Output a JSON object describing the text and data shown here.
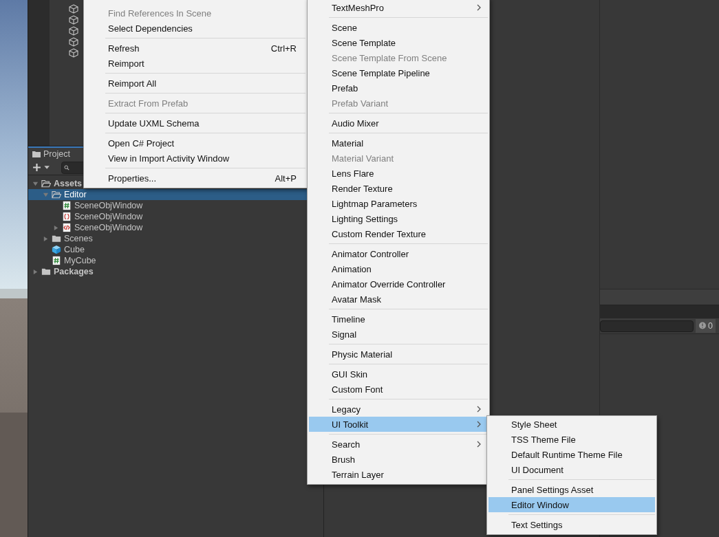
{
  "project": {
    "tab": "Project",
    "tree": [
      {
        "label": "Assets",
        "kind": "folder",
        "expanded": true,
        "selected": false,
        "children": [
          {
            "label": "Editor",
            "kind": "folder",
            "expanded": true,
            "selected": true,
            "children": [
              {
                "label": "SceneObjWindow",
                "kind": "script",
                "selected": false
              },
              {
                "label": "SceneObjWindow",
                "kind": "stylesheet",
                "selected": false
              },
              {
                "label": "SceneObjWindow",
                "kind": "uxml",
                "expanded": false,
                "selected": false
              }
            ]
          },
          {
            "label": "Scenes",
            "kind": "folder",
            "expanded": false,
            "selected": false
          },
          {
            "label": "Cube",
            "kind": "prefab",
            "selected": false
          },
          {
            "label": "MyCube",
            "kind": "script",
            "selected": false
          }
        ]
      },
      {
        "label": "Packages",
        "kind": "folder",
        "expanded": false,
        "selected": false
      }
    ]
  },
  "console": {
    "warning_count": "0"
  },
  "menus": [
    {
      "items": [
        {
          "kind": "item",
          "label": "Find References In Scene",
          "disabled": true,
          "selected": false,
          "submenu": false
        },
        {
          "kind": "item",
          "label": "Select Dependencies",
          "disabled": false,
          "selected": false,
          "submenu": false
        },
        {
          "kind": "separator"
        },
        {
          "kind": "item",
          "label": "Refresh",
          "shortcut": "Ctrl+R",
          "disabled": false,
          "selected": false,
          "submenu": false
        },
        {
          "kind": "item",
          "label": "Reimport",
          "disabled": false,
          "selected": false,
          "submenu": false
        },
        {
          "kind": "separator"
        },
        {
          "kind": "item",
          "label": "Reimport All",
          "disabled": false,
          "selected": false,
          "submenu": false
        },
        {
          "kind": "separator"
        },
        {
          "kind": "item",
          "label": "Extract From Prefab",
          "disabled": true,
          "selected": false,
          "submenu": false
        },
        {
          "kind": "separator"
        },
        {
          "kind": "item",
          "label": "Update UXML Schema",
          "disabled": false,
          "selected": false,
          "submenu": false
        },
        {
          "kind": "separator"
        },
        {
          "kind": "item",
          "label": "Open C# Project",
          "disabled": false,
          "selected": false,
          "submenu": false
        },
        {
          "kind": "item",
          "label": "View in Import Activity Window",
          "disabled": false,
          "selected": false,
          "submenu": false
        },
        {
          "kind": "separator"
        },
        {
          "kind": "item",
          "label": "Properties...",
          "shortcut": "Alt+P",
          "disabled": false,
          "selected": false,
          "submenu": false
        }
      ]
    },
    {
      "items": [
        {
          "kind": "item",
          "label": "TextMeshPro",
          "disabled": false,
          "selected": false,
          "submenu": true
        },
        {
          "kind": "separator"
        },
        {
          "kind": "item",
          "label": "Scene",
          "disabled": false,
          "selected": false,
          "submenu": false
        },
        {
          "kind": "item",
          "label": "Scene Template",
          "disabled": false,
          "selected": false,
          "submenu": false
        },
        {
          "kind": "item",
          "label": "Scene Template From Scene",
          "disabled": true,
          "selected": false,
          "submenu": false
        },
        {
          "kind": "item",
          "label": "Scene Template Pipeline",
          "disabled": false,
          "selected": false,
          "submenu": false
        },
        {
          "kind": "item",
          "label": "Prefab",
          "disabled": false,
          "selected": false,
          "submenu": false
        },
        {
          "kind": "item",
          "label": "Prefab Variant",
          "disabled": true,
          "selected": false,
          "submenu": false
        },
        {
          "kind": "separator"
        },
        {
          "kind": "item",
          "label": "Audio Mixer",
          "disabled": false,
          "selected": false,
          "submenu": false
        },
        {
          "kind": "separator"
        },
        {
          "kind": "item",
          "label": "Material",
          "disabled": false,
          "selected": false,
          "submenu": false
        },
        {
          "kind": "item",
          "label": "Material Variant",
          "disabled": true,
          "selected": false,
          "submenu": false
        },
        {
          "kind": "item",
          "label": "Lens Flare",
          "disabled": false,
          "selected": false,
          "submenu": false
        },
        {
          "kind": "item",
          "label": "Render Texture",
          "disabled": false,
          "selected": false,
          "submenu": false
        },
        {
          "kind": "item",
          "label": "Lightmap Parameters",
          "disabled": false,
          "selected": false,
          "submenu": false
        },
        {
          "kind": "item",
          "label": "Lighting Settings",
          "disabled": false,
          "selected": false,
          "submenu": false
        },
        {
          "kind": "item",
          "label": "Custom Render Texture",
          "disabled": false,
          "selected": false,
          "submenu": false
        },
        {
          "kind": "separator"
        },
        {
          "kind": "item",
          "label": "Animator Controller",
          "disabled": false,
          "selected": false,
          "submenu": false
        },
        {
          "kind": "item",
          "label": "Animation",
          "disabled": false,
          "selected": false,
          "submenu": false
        },
        {
          "kind": "item",
          "label": "Animator Override Controller",
          "disabled": false,
          "selected": false,
          "submenu": false
        },
        {
          "kind": "item",
          "label": "Avatar Mask",
          "disabled": false,
          "selected": false,
          "submenu": false
        },
        {
          "kind": "separator"
        },
        {
          "kind": "item",
          "label": "Timeline",
          "disabled": false,
          "selected": false,
          "submenu": false
        },
        {
          "kind": "item",
          "label": "Signal",
          "disabled": false,
          "selected": false,
          "submenu": false
        },
        {
          "kind": "separator"
        },
        {
          "kind": "item",
          "label": "Physic Material",
          "disabled": false,
          "selected": false,
          "submenu": false
        },
        {
          "kind": "separator"
        },
        {
          "kind": "item",
          "label": "GUI Skin",
          "disabled": false,
          "selected": false,
          "submenu": false
        },
        {
          "kind": "item",
          "label": "Custom Font",
          "disabled": false,
          "selected": false,
          "submenu": false
        },
        {
          "kind": "separator"
        },
        {
          "kind": "item",
          "label": "Legacy",
          "disabled": false,
          "selected": false,
          "submenu": true
        },
        {
          "kind": "item",
          "label": "UI Toolkit",
          "disabled": false,
          "selected": true,
          "submenu": true
        },
        {
          "kind": "separator"
        },
        {
          "kind": "item",
          "label": "Search",
          "disabled": false,
          "selected": false,
          "submenu": true
        },
        {
          "kind": "item",
          "label": "Brush",
          "disabled": false,
          "selected": false,
          "submenu": false
        },
        {
          "kind": "item",
          "label": "Terrain Layer",
          "disabled": false,
          "selected": false,
          "submenu": false
        }
      ]
    },
    {
      "items": [
        {
          "kind": "item",
          "label": "Style Sheet",
          "disabled": false,
          "selected": false,
          "submenu": false
        },
        {
          "kind": "item",
          "label": "TSS Theme File",
          "disabled": false,
          "selected": false,
          "submenu": false
        },
        {
          "kind": "item",
          "label": "Default Runtime Theme File",
          "disabled": false,
          "selected": false,
          "submenu": false
        },
        {
          "kind": "item",
          "label": "UI Document",
          "disabled": false,
          "selected": false,
          "submenu": false
        },
        {
          "kind": "separator"
        },
        {
          "kind": "item",
          "label": "Panel Settings Asset",
          "disabled": false,
          "selected": false,
          "submenu": false
        },
        {
          "kind": "item",
          "label": "Editor Window",
          "disabled": false,
          "selected": true,
          "submenu": false
        },
        {
          "kind": "separator"
        },
        {
          "kind": "item",
          "label": "Text Settings",
          "disabled": false,
          "selected": false,
          "submenu": false
        }
      ]
    }
  ]
}
